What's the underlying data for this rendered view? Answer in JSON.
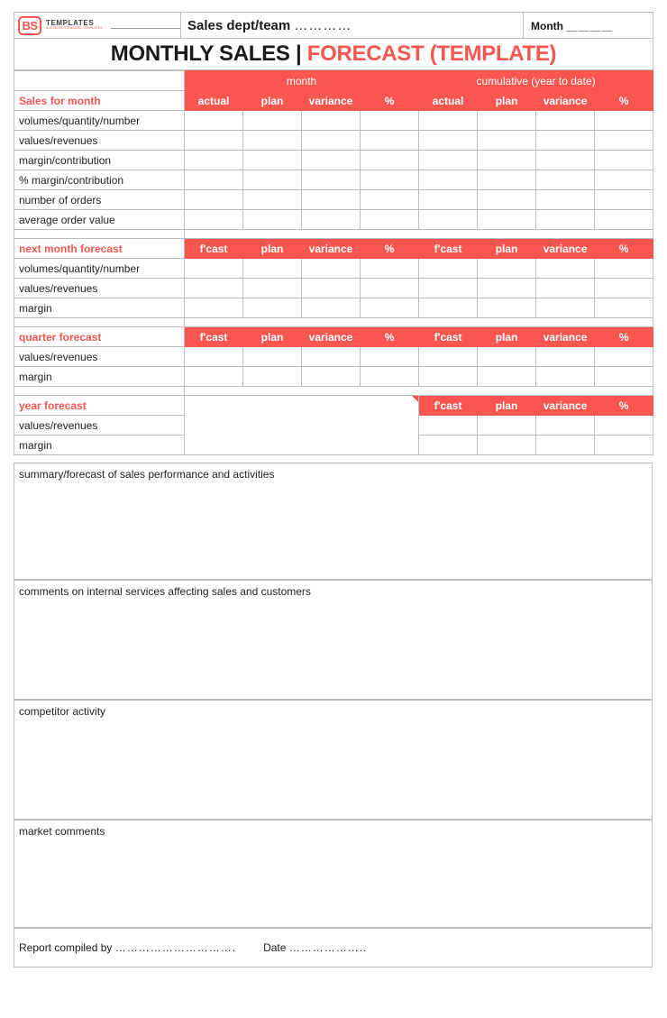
{
  "brand": {
    "mark": "BS",
    "name": "TEMPLATES",
    "tagline": "BUSINESS STANDARD TEMPLATES"
  },
  "header": {
    "dept_label": "Sales dept/team",
    "dept_dots": "…………",
    "month_label": "Month",
    "month_dots": "＿＿＿＿",
    "title_main": "MONTHLY SALES",
    "title_separator": " | ",
    "title_accent": "FORECAST (TEMPLATE)"
  },
  "colors": {
    "accent": "#f9564f",
    "grid": "#b9bcc2",
    "text": "#222222",
    "white": "#ffffff"
  },
  "table": {
    "group_headers": {
      "left_blank": "",
      "month": "month",
      "cumulative": "cumulative (year to date)"
    },
    "sections": [
      {
        "id": "sales-for-month",
        "title": "Sales for month",
        "columns": [
          "actual",
          "plan",
          "variance",
          "%",
          "actual",
          "plan",
          "variance",
          "%"
        ],
        "rows": [
          "volumes/quantity/number",
          "values/revenues",
          "margin/contribution",
          "% margin/contribution",
          "number of orders",
          "average order value"
        ]
      },
      {
        "id": "next-month-forecast",
        "title": "next month forecast",
        "columns": [
          "f'cast",
          "plan",
          "variance",
          "%",
          "f'cast",
          "plan",
          "variance",
          "%"
        ],
        "rows": [
          "volumes/quantity/number",
          "values/revenues",
          "margin"
        ]
      },
      {
        "id": "quarter-forecast",
        "title": "quarter forecast",
        "columns": [
          "f'cast",
          "plan",
          "variance",
          "%",
          "f'cast",
          "plan",
          "variance",
          "%"
        ],
        "rows": [
          "values/revenues",
          "margin"
        ]
      },
      {
        "id": "year-forecast",
        "title": "year forecast",
        "columns": [
          "f'cast",
          "plan",
          "variance",
          "%"
        ],
        "rows": [
          "values/revenues",
          "margin"
        ]
      }
    ]
  },
  "notes": [
    {
      "id": "summary",
      "label": "summary/forecast of sales performance and activities"
    },
    {
      "id": "internal-services",
      "label": "comments on internal services affecting sales and customers"
    },
    {
      "id": "competitor",
      "label": "competitor activity"
    },
    {
      "id": "market",
      "label": "market comments"
    }
  ],
  "footer": {
    "compiled_label": "Report compiled by",
    "compiled_dots": "………………………….",
    "date_label": "Date",
    "date_dots": "……………….."
  }
}
